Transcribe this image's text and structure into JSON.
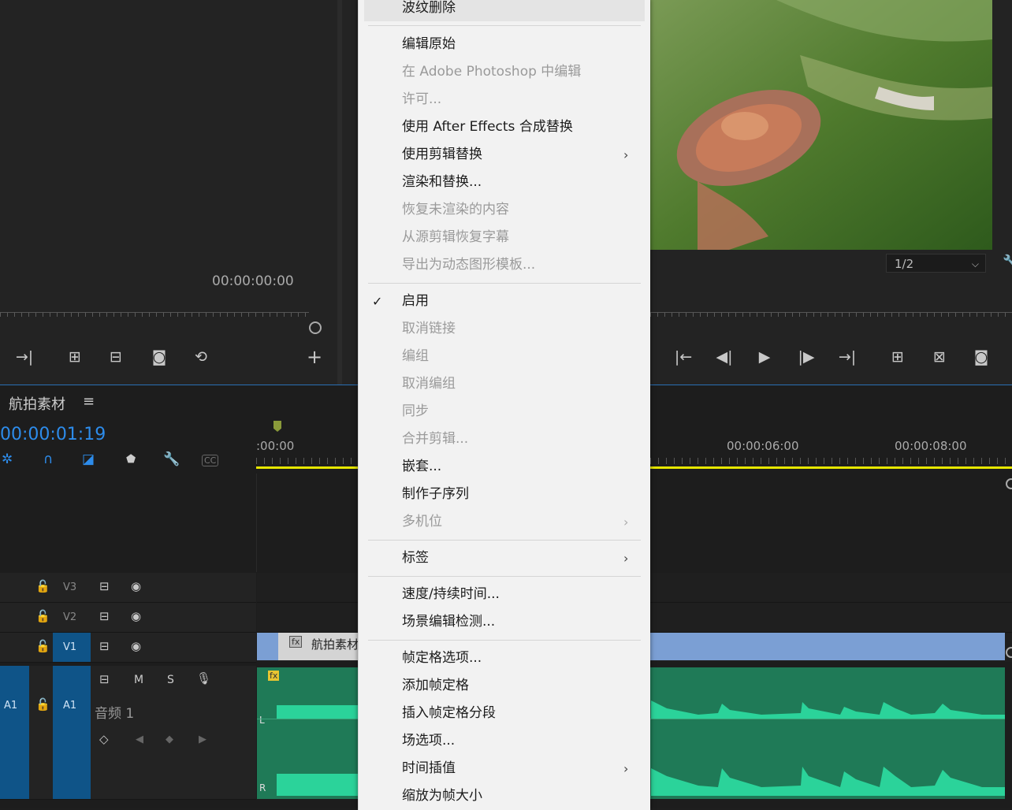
{
  "source_monitor": {
    "timecode": "00:00:00:00",
    "controls": [
      "insert",
      "lift",
      "extract",
      "camera",
      "replace",
      "add"
    ]
  },
  "program_monitor": {
    "resolution": "1/2",
    "controls": [
      "to-in",
      "step-back",
      "play",
      "step-forward",
      "to-out",
      "lift",
      "extract",
      "camera"
    ]
  },
  "timeline": {
    "title": "航拍素材",
    "menu_icon": "≡",
    "timecode": "00:00:01:19",
    "ruler_labels": [
      ":00:00",
      "00:00:06:00",
      "00:00:08:00"
    ],
    "tracks": {
      "v3": "V3",
      "v2": "V2",
      "v1": "V1",
      "a1_src": "A1",
      "a1": "A1",
      "a1_name": "音频 1",
      "m": "M",
      "s": "S"
    },
    "clip": {
      "name": "航拍素材",
      "fx": "fx",
      "audio_fx": "fx",
      "channel_l": "L",
      "channel_r": "R"
    },
    "colors": {
      "accent": "#2d8ceb",
      "video_clip": "#7b9fd4",
      "audio_clip": "#1f7a57",
      "waveform": "#2bd39a",
      "playhead_bar": "#e6e600"
    }
  },
  "context_menu": {
    "items": [
      {
        "label": "波纹删除",
        "enabled": true
      },
      {
        "label": "编辑原始",
        "enabled": true
      },
      {
        "label": "在 Adobe Photoshop 中编辑",
        "enabled": false
      },
      {
        "label": "许可...",
        "enabled": false
      },
      {
        "label": "使用 After Effects 合成替换",
        "enabled": true
      },
      {
        "label": "使用剪辑替换",
        "enabled": true,
        "submenu": true
      },
      {
        "label": "渲染和替换...",
        "enabled": true
      },
      {
        "label": "恢复未渲染的内容",
        "enabled": false
      },
      {
        "label": "从源剪辑恢复字幕",
        "enabled": false
      },
      {
        "label": "导出为动态图形模板...",
        "enabled": false
      },
      {
        "label": "启用",
        "enabled": true,
        "checked": true
      },
      {
        "label": "取消链接",
        "enabled": false
      },
      {
        "label": "编组",
        "enabled": false
      },
      {
        "label": "取消编组",
        "enabled": false
      },
      {
        "label": "同步",
        "enabled": false
      },
      {
        "label": "合并剪辑...",
        "enabled": false
      },
      {
        "label": "嵌套...",
        "enabled": true
      },
      {
        "label": "制作子序列",
        "enabled": true
      },
      {
        "label": "多机位",
        "enabled": false,
        "submenu": true
      },
      {
        "label": "标签",
        "enabled": true,
        "submenu": true
      },
      {
        "label": "速度/持续时间...",
        "enabled": true
      },
      {
        "label": "场景编辑检测...",
        "enabled": true
      },
      {
        "label": "帧定格选项...",
        "enabled": true
      },
      {
        "label": "添加帧定格",
        "enabled": true
      },
      {
        "label": "插入帧定格分段",
        "enabled": true
      },
      {
        "label": "场选项...",
        "enabled": true
      },
      {
        "label": "时间插值",
        "enabled": true,
        "submenu": true
      },
      {
        "label": "缩放为帧大小",
        "enabled": true
      }
    ]
  }
}
